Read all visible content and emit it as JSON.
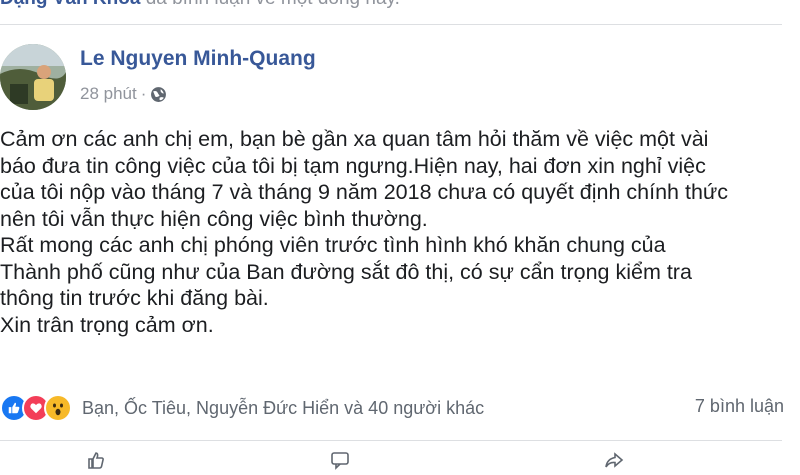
{
  "top": {
    "name": "Đặng Văn Khoa",
    "text": "đã bình luận về một dòng này."
  },
  "post": {
    "author": "Le Nguyen Minh-Quang",
    "time": "28 phút",
    "separator": "·",
    "privacy_icon": "globe-icon",
    "paragraphs": [
      "Cảm ơn các anh chị em, bạn bè gần xa quan tâm hỏi thăm về việc một vài",
      "báo đưa tin công việc của tôi bị tạm ngưng.Hiện nay, hai đơn xin nghỉ việc",
      "của tôi nộp vào tháng 7 và tháng 9 năm 2018 chưa có quyết định chính thức",
      "nên tôi vẫn thực hiện công việc bình thường.",
      "Rất mong các anh chị phóng viên trước tình hình khó khăn chung của",
      "Thành phố cũng như của Ban đường sắt đô thị, có sự cẩn trọng kiểm tra",
      "thông tin trước khi đăng bài.",
      "Xin trân trọng cảm ơn."
    ]
  },
  "reactions": {
    "icons": [
      "like-icon",
      "love-icon",
      "wow-icon"
    ],
    "summary": "Bạn, Ốc Tiêu, Nguyễn Đức Hiển và 40 người khác",
    "comments": "7 bình luận"
  },
  "colors": {
    "link_blue": "#385898",
    "meta_gray": "#90949c",
    "like_blue": "#1877f2",
    "love_red": "#f33e58",
    "wow_yellow": "#f7b928"
  }
}
